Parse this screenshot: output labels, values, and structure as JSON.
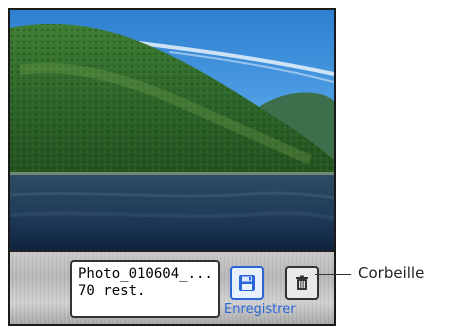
{
  "photo": {
    "scene": "mountain-lake-landscape"
  },
  "toolbar": {
    "file_name": "Photo_010604_...",
    "remaining": "70 rest.",
    "save_label": "Enregistrer",
    "save_icon": "floppy-disk-icon",
    "trash_icon": "trash-can-icon"
  },
  "callout": {
    "label": "Corbeille"
  },
  "colors": {
    "accent": "#2a66d6",
    "sky": "#3f8fd8",
    "forest": "#2f6f2a",
    "water": "#1d3a57"
  }
}
